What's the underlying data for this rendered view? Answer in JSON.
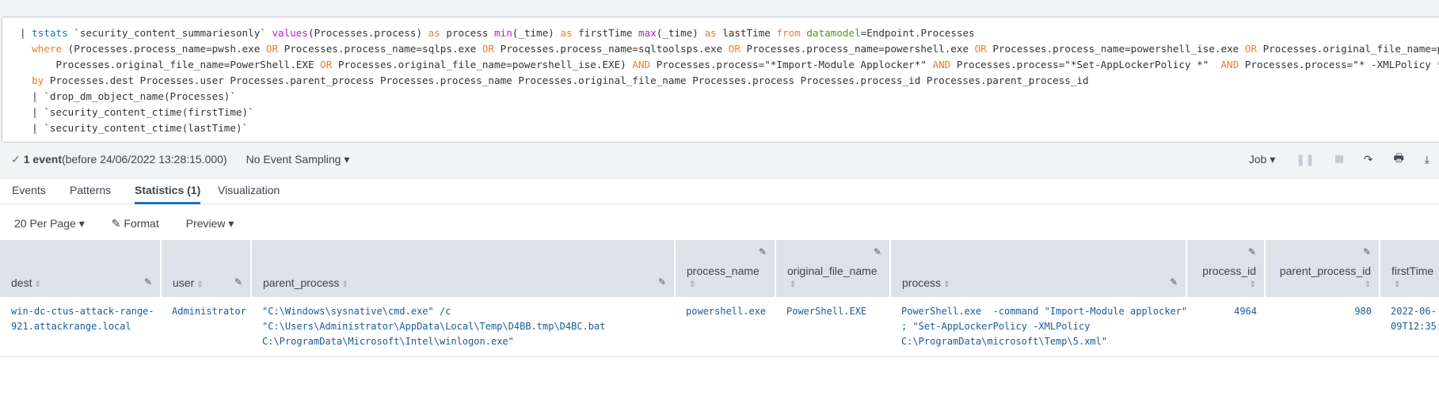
{
  "search": {
    "lines": [
      [
        [
          "|",
          "plain"
        ],
        [
          " tstats",
          "cmd"
        ],
        [
          " `security_content_summariesonly` ",
          "plain"
        ],
        [
          "values",
          "fn"
        ],
        [
          "(Processes.process) ",
          "plain"
        ],
        [
          "as",
          "kw"
        ],
        [
          " process ",
          "plain"
        ],
        [
          "min",
          "fn"
        ],
        [
          "(_time) ",
          "plain"
        ],
        [
          "as",
          "kw"
        ],
        [
          " firstTime ",
          "plain"
        ],
        [
          "max",
          "fn"
        ],
        [
          "(_time) ",
          "plain"
        ],
        [
          "as",
          "kw"
        ],
        [
          " lastTime ",
          "plain"
        ],
        [
          "from",
          "kw"
        ],
        [
          " ",
          "plain"
        ],
        [
          "datamodel",
          "arg"
        ],
        [
          "=Endpoint.Processes",
          "plain"
        ]
      ],
      [
        [
          "  ",
          "plain"
        ],
        [
          "where",
          "kw"
        ],
        [
          " (Processes.process_name=pwsh.exe ",
          "plain"
        ],
        [
          "OR",
          "kw"
        ],
        [
          " Processes.process_name=sqlps.exe ",
          "plain"
        ],
        [
          "OR",
          "kw"
        ],
        [
          " Processes.process_name=sqltoolsps.exe ",
          "plain"
        ],
        [
          "OR",
          "kw"
        ],
        [
          " Processes.process_name=powershell.exe ",
          "plain"
        ],
        [
          "OR",
          "kw"
        ],
        [
          " Processes.process_name=powershell_ise.exe ",
          "plain"
        ],
        [
          "OR",
          "kw"
        ],
        [
          " Processes.original_file_name=pwsh.dll ",
          "plain"
        ],
        [
          "OR",
          "kw"
        ]
      ],
      [
        [
          "      Processes.original_file_name=PowerShell.EXE ",
          "plain"
        ],
        [
          "OR",
          "kw"
        ],
        [
          " Processes.original_file_name=powershell_ise.EXE) ",
          "plain"
        ],
        [
          "AND",
          "kw"
        ],
        [
          " Processes.process=\"*Import-Module Applocker*\" ",
          "plain"
        ],
        [
          "AND",
          "kw"
        ],
        [
          " Processes.process=\"*Set-AppLockerPolicy *\"  ",
          "plain"
        ],
        [
          "AND",
          "kw"
        ],
        [
          " Processes.process=\"* -XMLPolicy *\"",
          "plain"
        ]
      ],
      [
        [
          "  ",
          "plain"
        ],
        [
          "by",
          "kw"
        ],
        [
          " Processes.dest Processes.user Processes.parent_process Processes.process_name Processes.original_file_name Processes.process Processes.process_id Processes.parent_process_id",
          "plain"
        ]
      ],
      [
        [
          "  | `drop_dm_object_name(Processes)`",
          "plain"
        ]
      ],
      [
        [
          "  | `security_content_ctime(firstTime)`",
          "plain"
        ]
      ],
      [
        [
          "  | `security_content_ctime(lastTime)`",
          "plain"
        ]
      ]
    ]
  },
  "status": {
    "count": "1 event",
    "before": " (before 24/06/2022 13:28:15.000)",
    "sampling": "No Event Sampling ▾",
    "job": "Job ▾"
  },
  "tabs": [
    "Events",
    "Patterns",
    "Statistics (1)",
    "Visualization"
  ],
  "toolbar": {
    "per_page": "20 Per Page ▾",
    "format": "Format",
    "preview": "Preview ▾"
  },
  "table": {
    "columns": [
      "dest",
      "user",
      "parent_process",
      "process_name",
      "original_file_name",
      "process",
      "process_id",
      "parent_process_id",
      "firstTime"
    ],
    "rows": [
      [
        "win-dc-ctus-attack-range-\n921.attackrange.local",
        "Administrator",
        "\"C:\\Windows\\sysnative\\cmd.exe\" /c\n\"C:\\Users\\Administrator\\AppData\\Local\\Temp\\D4BB.tmp\\D4BC.bat\nC:\\ProgramData\\Microsoft\\Intel\\winlogon.exe\"",
        "powershell.exe",
        "PowerShell.EXE",
        "PowerShell.exe  -command \"Import-Module applocker\"\n; \"Set-AppLockerPolicy -XMLPolicy\nC:\\ProgramData\\microsoft\\Temp\\5.xml\"",
        "4964",
        "980",
        "2022-06-\n09T12:35:"
      ]
    ]
  },
  "colors": {
    "accent": "#1a73c4",
    "keyword": "#ef7c27",
    "function": "#c219c9",
    "argument": "#4d9a0f"
  }
}
